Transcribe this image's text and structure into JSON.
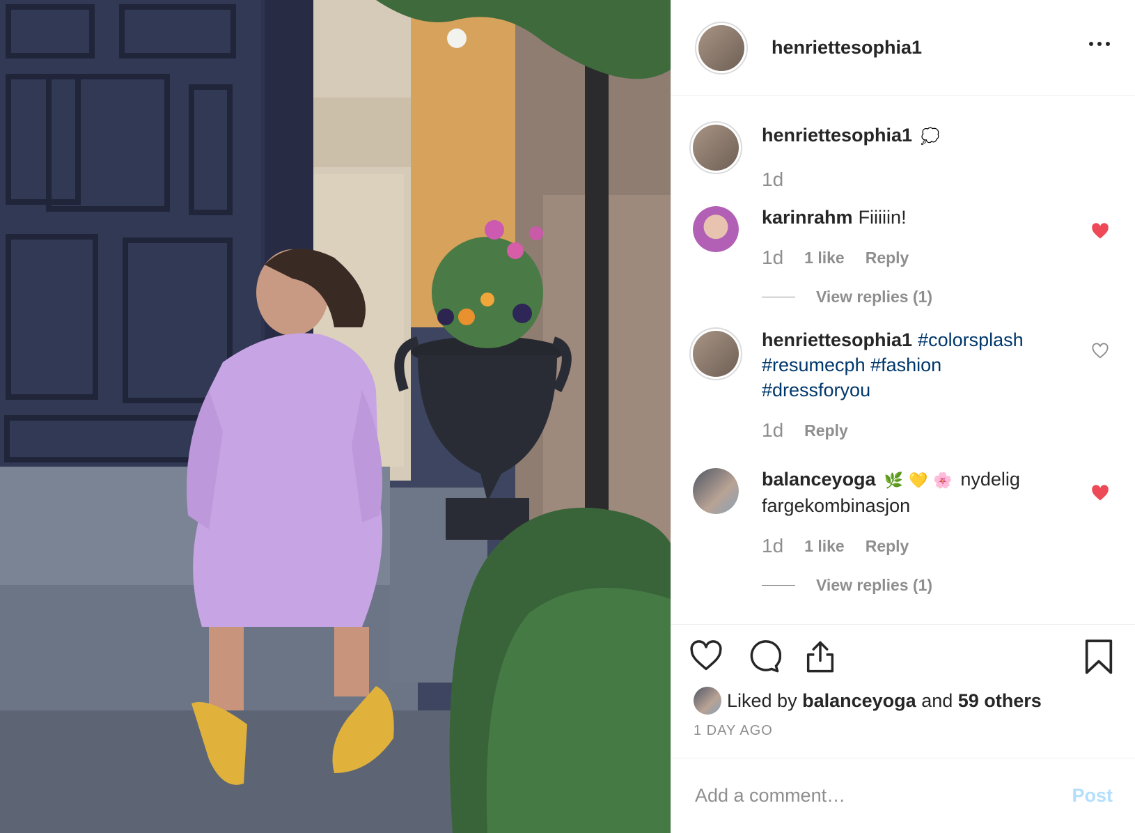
{
  "header": {
    "username": "henriettesophia1",
    "more_icon": "more-horizontal-icon"
  },
  "comments": [
    {
      "username": "henriettesophia1",
      "text": "",
      "trailing_emoji": "💭",
      "time": "1d",
      "likes_label": "",
      "reply_label": "",
      "view_replies": "",
      "liked": null,
      "avatar_color": "#8b7c6e",
      "ringed": true
    },
    {
      "username": "karinrahm",
      "text": "Fiiiiin!",
      "trailing_emoji": "",
      "time": "1d",
      "likes_label": "1 like",
      "reply_label": "Reply",
      "view_replies": "View replies (1)",
      "liked": true,
      "avatar_color": "#b25fb6",
      "ringed": false
    },
    {
      "username": "henriettesophia1",
      "text": "",
      "hashtags": [
        "#colorsplash",
        "#resumecph",
        "#fashion",
        "#dressforyou"
      ],
      "time": "1d",
      "likes_label": "",
      "reply_label": "Reply",
      "view_replies": "",
      "liked": false,
      "avatar_color": "#8b7c6e",
      "ringed": true
    },
    {
      "username": "balanceyoga",
      "text": "nydelig fargekombinasjon",
      "emojis": [
        "🌿",
        "💛",
        "🌸"
      ],
      "time": "1d",
      "likes_label": "1 like",
      "reply_label": "Reply",
      "view_replies": "View replies (1)",
      "liked": true,
      "avatar_color": "#6a6f7a",
      "ringed": false
    }
  ],
  "actions": {
    "like_icon": "heart-icon",
    "comment_icon": "comment-icon",
    "share_icon": "share-icon",
    "save_icon": "bookmark-icon"
  },
  "likes": {
    "prefix": "Liked by",
    "user": "balanceyoga",
    "middle": "and",
    "others": "59 others"
  },
  "timestamp": "1 DAY AGO",
  "add_comment": {
    "placeholder": "Add a comment…",
    "post_label": "Post"
  },
  "colors": {
    "like_red": "#ed4956",
    "hashtag_blue": "#00376b",
    "muted_gray": "#8e8e8e",
    "post_disabled": "#b2dffc"
  }
}
